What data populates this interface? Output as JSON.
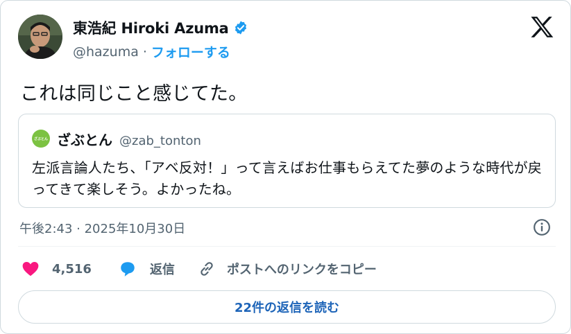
{
  "author": {
    "display_name": "東浩紀 Hiroki Azuma",
    "handle": "@hazuma",
    "separator": "·",
    "follow_label": "フォローする"
  },
  "icons": {
    "verified": "verified-badge-icon",
    "logo": "x-logo-icon",
    "info": "info-icon",
    "like": "heart-icon",
    "reply": "speech-bubble-icon",
    "copy": "link-icon"
  },
  "colors": {
    "accent": "#1d9bf0",
    "like": "#f91880",
    "quote_avatar_bg": "#7cc242",
    "replies_text": "#1d64b8"
  },
  "tweet": {
    "text": "これは同じこと感じてた。"
  },
  "quote": {
    "avatar_text": "ざぶとん",
    "name": "ざぶとん",
    "handle": "@zab_tonton",
    "text": "左派言論人たち、「アベ反対！」って言えばお仕事もらえてた夢のような時代が戻ってきて楽しそう。よかったね。"
  },
  "meta": {
    "timestamp": "午後2:43 · 2025年10月30日"
  },
  "actions": {
    "like_count": "4,516",
    "reply_label": "返信",
    "copy_label": "ポストへのリンクをコピー"
  },
  "replies_button": {
    "label": "22件の返信を読む"
  }
}
